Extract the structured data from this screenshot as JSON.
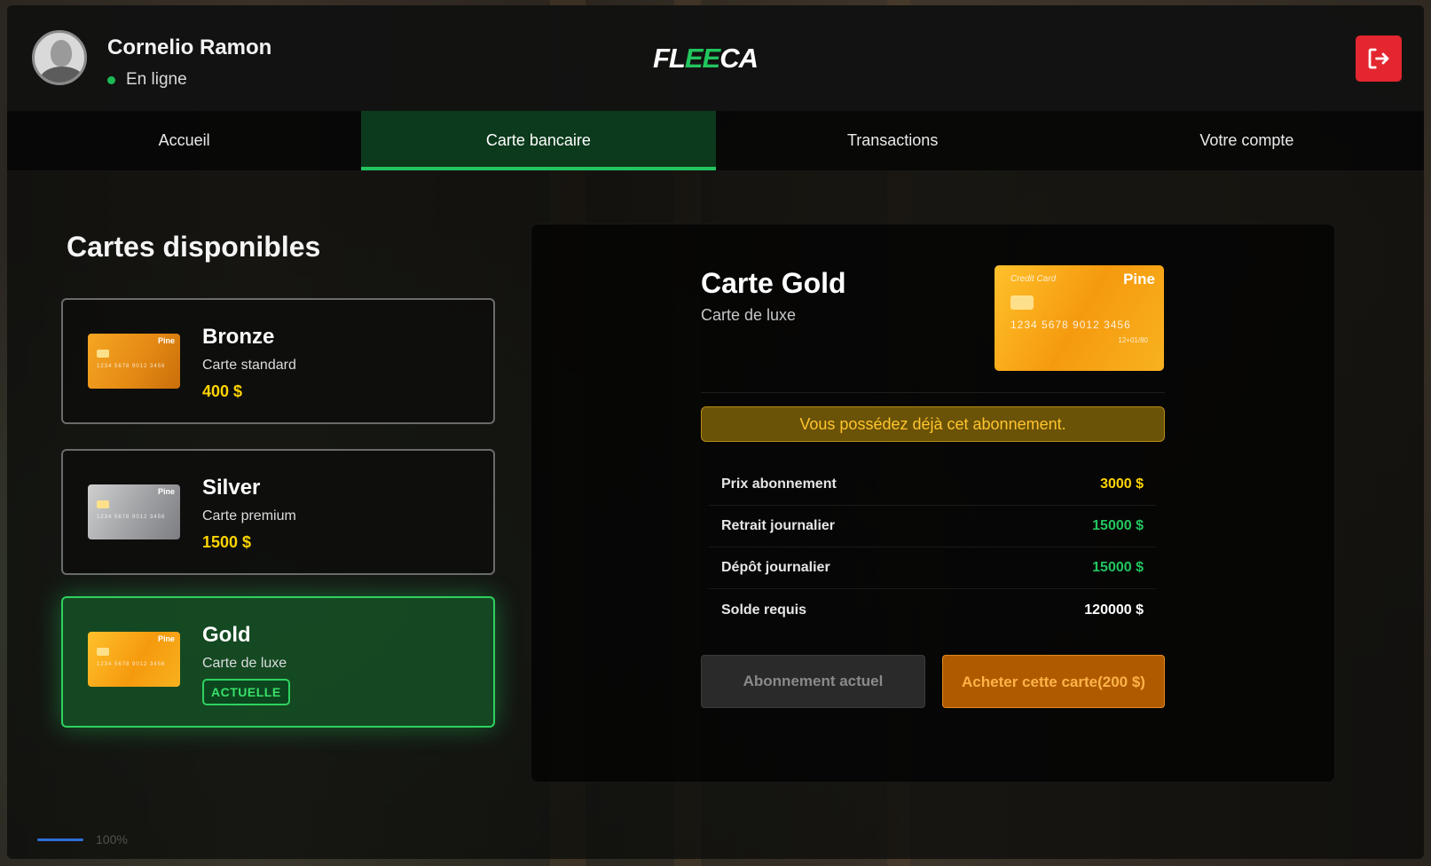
{
  "header": {
    "user_name": "Cornelio Ramon",
    "status_text": "En ligne",
    "logo_part1": "FL",
    "logo_part2": "EE",
    "logo_part3": "CA"
  },
  "tabs": [
    {
      "label": "Accueil"
    },
    {
      "label": "Carte bancaire"
    },
    {
      "label": "Transactions"
    },
    {
      "label": "Votre compte"
    }
  ],
  "cards_section": {
    "title": "Cartes disponibles",
    "items": [
      {
        "name": "Bronze",
        "desc": "Carte standard",
        "price": "400 $"
      },
      {
        "name": "Silver",
        "desc": "Carte premium",
        "price": "1500 $"
      },
      {
        "name": "Gold",
        "desc": "Carte de luxe",
        "badge": "ACTUELLE"
      }
    ]
  },
  "mini_card_brand": "Pine",
  "detail": {
    "title": "Carte Gold",
    "subtitle": "Carte de luxe",
    "card_brand": "Pine",
    "card_label": "Credit Card",
    "card_number": "1234 5678 9012 3456",
    "card_exp": "12+01/80",
    "notice": "Vous possédez déjà cet abonnement.",
    "rows": [
      {
        "label": "Prix abonnement",
        "value": "3000 $",
        "color": "#ffd400"
      },
      {
        "label": "Retrait journalier",
        "value": "15000 $",
        "color": "#22c55e"
      },
      {
        "label": "Dépôt journalier",
        "value": "15000 $",
        "color": "#22c55e"
      },
      {
        "label": "Solde requis",
        "value": "120000 $",
        "color": "#ffffff"
      }
    ],
    "btn_current": "Abonnement actuel",
    "btn_buy_line1": "Acheter cette carte",
    "btn_buy_line2": "(200 $)"
  },
  "loader_text": "100%",
  "colors": {
    "accent": "#22c55e",
    "logout": "#e3262f",
    "price": "#ffd400",
    "notice": "#ffc52e"
  },
  "icons": {
    "logout": "logout-icon",
    "avatar": "user-avatar-icon"
  }
}
